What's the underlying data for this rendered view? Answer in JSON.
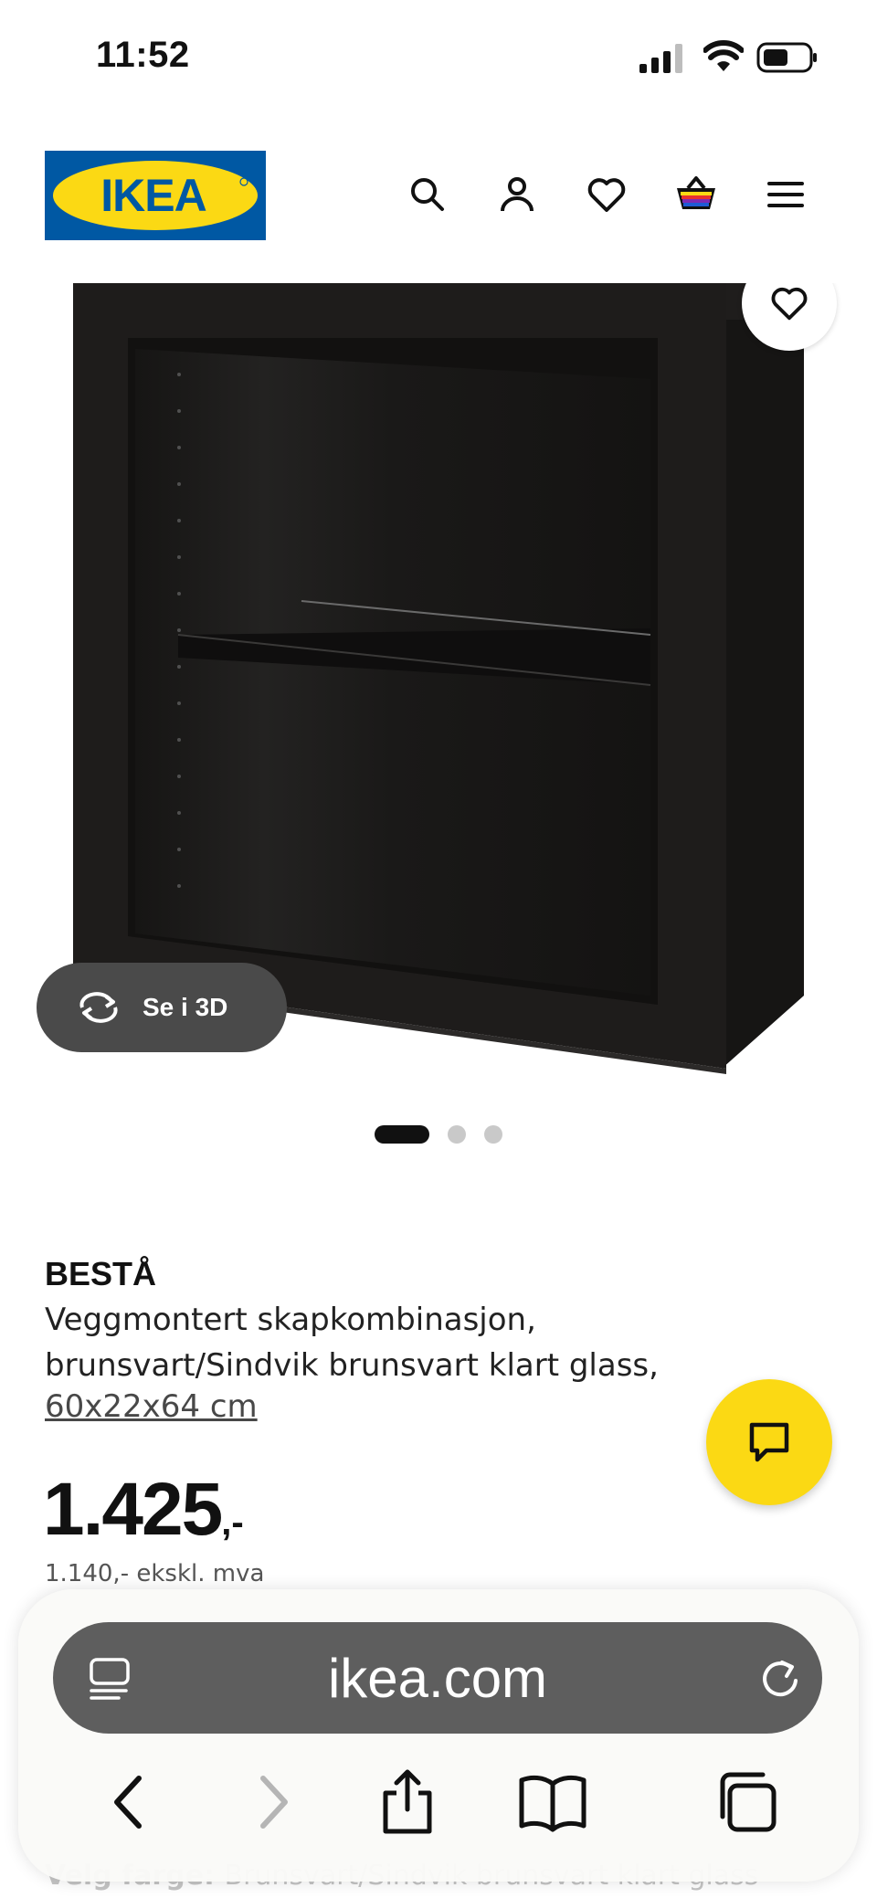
{
  "status_bar": {
    "time": "11:52"
  },
  "header": {
    "logo_text": "IKEA",
    "icons": [
      "search-icon",
      "profile-icon",
      "heart-icon",
      "cart-icon",
      "menu-icon"
    ]
  },
  "gallery": {
    "view_3d_label": "Se i 3D",
    "slide_count": 3,
    "active_slide": 1
  },
  "product": {
    "name": "BESTÅ",
    "description": "Veggmontert skapkombinasjon, brunsvart/Sindvik brunsvart klart glass,",
    "size": "60x22x64 cm",
    "price": "1.425",
    "price_suffix": ",-",
    "price_ex_vat": "1.140,- ekskl. mva"
  },
  "behind_toolbar": {
    "label": "Velg farge:",
    "value": "Brunsvart/Sindvik brunsvart klart glass"
  },
  "safari": {
    "url": "ikea.com",
    "buttons": [
      "back-icon",
      "forward-icon",
      "share-icon",
      "bookmarks-icon",
      "tabs-icon"
    ]
  },
  "colors": {
    "ikea_blue": "#0058a3",
    "ikea_yellow": "#fbd914",
    "cabinet": "#1c1a19"
  }
}
